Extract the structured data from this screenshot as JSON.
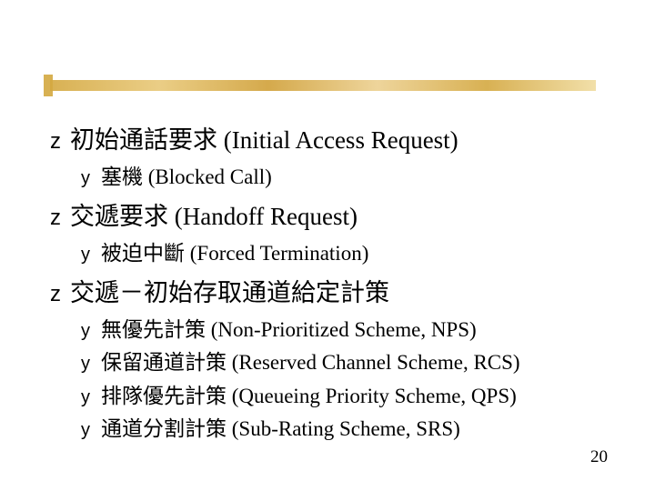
{
  "page_number": "20",
  "items": [
    {
      "level": 1,
      "text": "初始通話要求 (Initial Access Request)"
    },
    {
      "level": 2,
      "text": "塞機 (Blocked Call)"
    },
    {
      "level": 1,
      "text": "交遞要求 (Handoff Request)"
    },
    {
      "level": 2,
      "text": "被迫中斷 (Forced Termination)"
    },
    {
      "level": 1,
      "text": "交遞－初始存取通道給定計策"
    },
    {
      "level": 2,
      "text": "無優先計策 (Non-Prioritized Scheme, NPS)"
    },
    {
      "level": 2,
      "text": "保留通道計策 (Reserved Channel Scheme, RCS)"
    },
    {
      "level": 2,
      "text": "排隊優先計策 (Queueing Priority Scheme, QPS)"
    },
    {
      "level": 2,
      "text": "通道分割計策 (Sub-Rating Scheme, SRS)"
    }
  ]
}
